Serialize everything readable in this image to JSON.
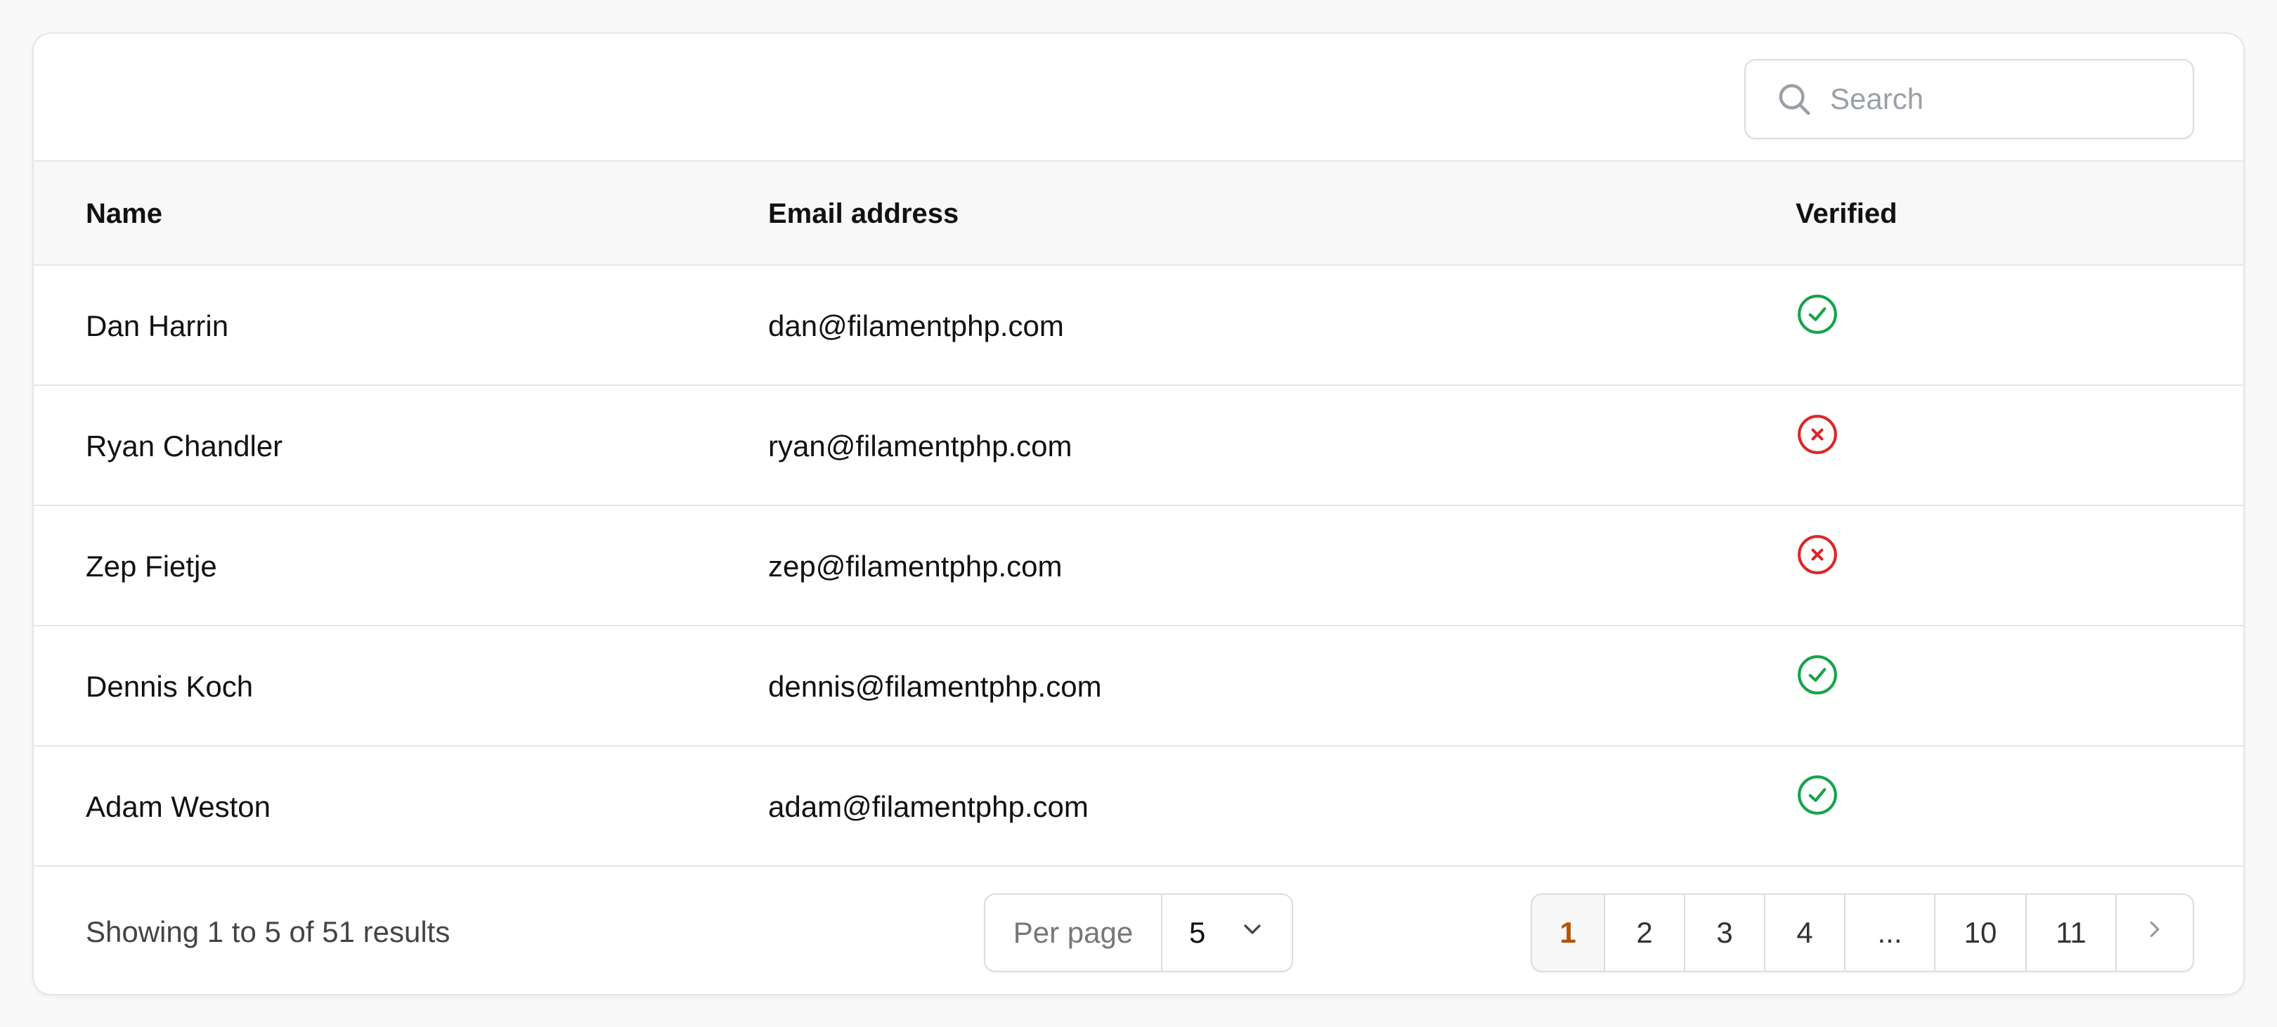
{
  "search": {
    "placeholder": "Search",
    "icon": "search-icon"
  },
  "table": {
    "columns": [
      "Name",
      "Email address",
      "Verified"
    ],
    "rows": [
      {
        "name": "Dan Harrin",
        "email": "dan@filamentphp.com",
        "verified": true
      },
      {
        "name": "Ryan Chandler",
        "email": "ryan@filamentphp.com",
        "verified": false
      },
      {
        "name": "Zep Fietje",
        "email": "zep@filamentphp.com",
        "verified": false
      },
      {
        "name": "Dennis Koch",
        "email": "dennis@filamentphp.com",
        "verified": true
      },
      {
        "name": "Adam Weston",
        "email": "adam@filamentphp.com",
        "verified": true
      }
    ]
  },
  "footer": {
    "summary": "Showing 1 to 5 of 51 results",
    "per_page_label": "Per page",
    "per_page_value": "5",
    "pages": [
      "1",
      "2",
      "3",
      "4",
      "...",
      "10",
      "11"
    ],
    "current_page": "1"
  },
  "colors": {
    "verified": "#16a34a",
    "unverified": "#dc2626",
    "active_page": "#b45309"
  }
}
